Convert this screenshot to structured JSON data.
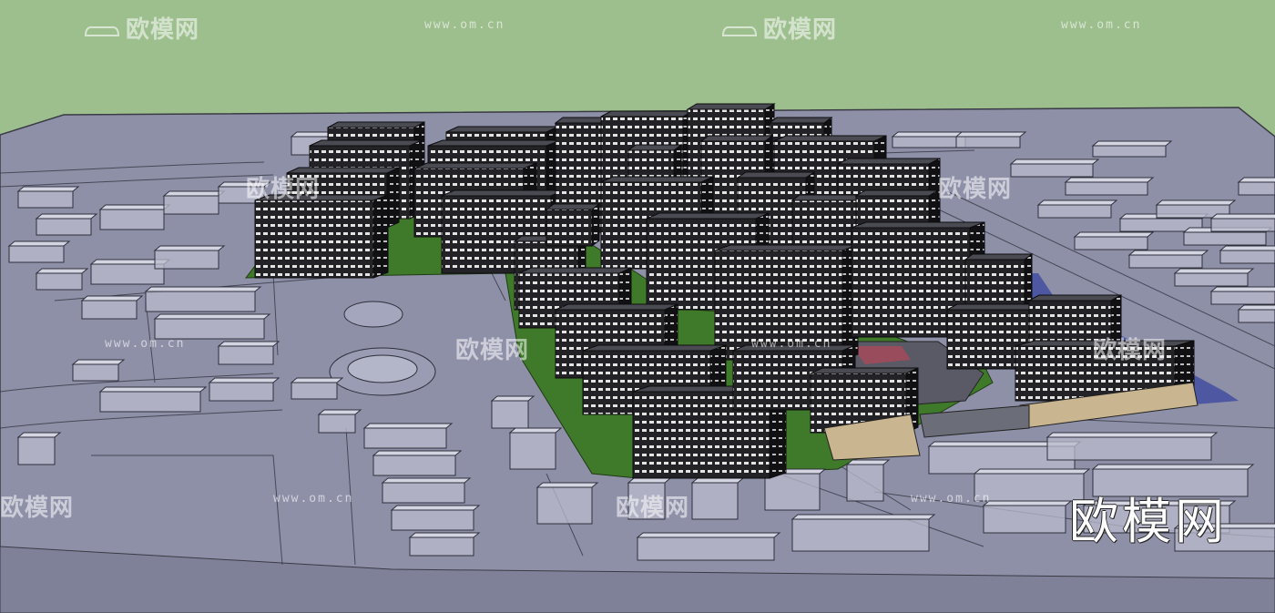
{
  "image": {
    "subject": "3D massing model of a residential district",
    "sky_color": "#9dbf8e",
    "ground_color": "#8e90a8",
    "lawn_color": "#3f7a2a",
    "tower_color": "#2a2a2e",
    "window_color": "#d9d9d9"
  },
  "watermarks": {
    "logo_text": "欧模网",
    "url_text": "www.om.cn",
    "corner_text": "欧模网"
  }
}
